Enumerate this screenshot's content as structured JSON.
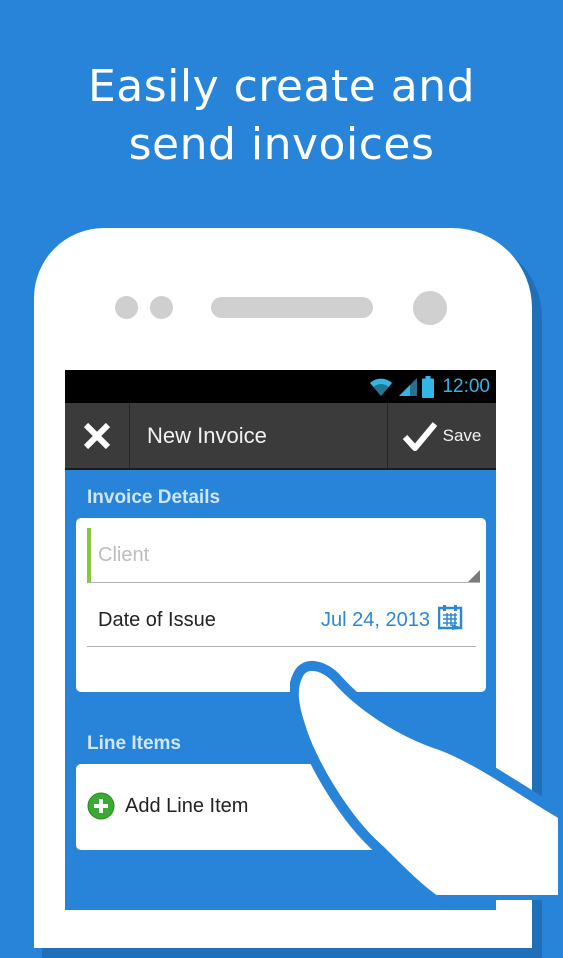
{
  "headline": {
    "line1": "Easily create and",
    "line2": "send invoices"
  },
  "status_bar": {
    "time": "12:00",
    "icons": [
      "wifi-icon",
      "signal-icon",
      "battery-icon"
    ]
  },
  "action_bar": {
    "title": "New Invoice",
    "save_label": "Save",
    "close_icon": "close-icon",
    "save_icon": "checkmark-icon"
  },
  "invoice_details": {
    "section_label": "Invoice Details",
    "client_placeholder": "Client",
    "date_label": "Date of Issue",
    "date_value": "Jul 24, 2013"
  },
  "line_items": {
    "section_label": "Line Items",
    "add_label": "Add Line Item"
  },
  "colors": {
    "background": "#2784d8",
    "accent_green": "#8cc63f",
    "link_blue": "#2d87d6",
    "status_blue": "#33b5e5"
  }
}
